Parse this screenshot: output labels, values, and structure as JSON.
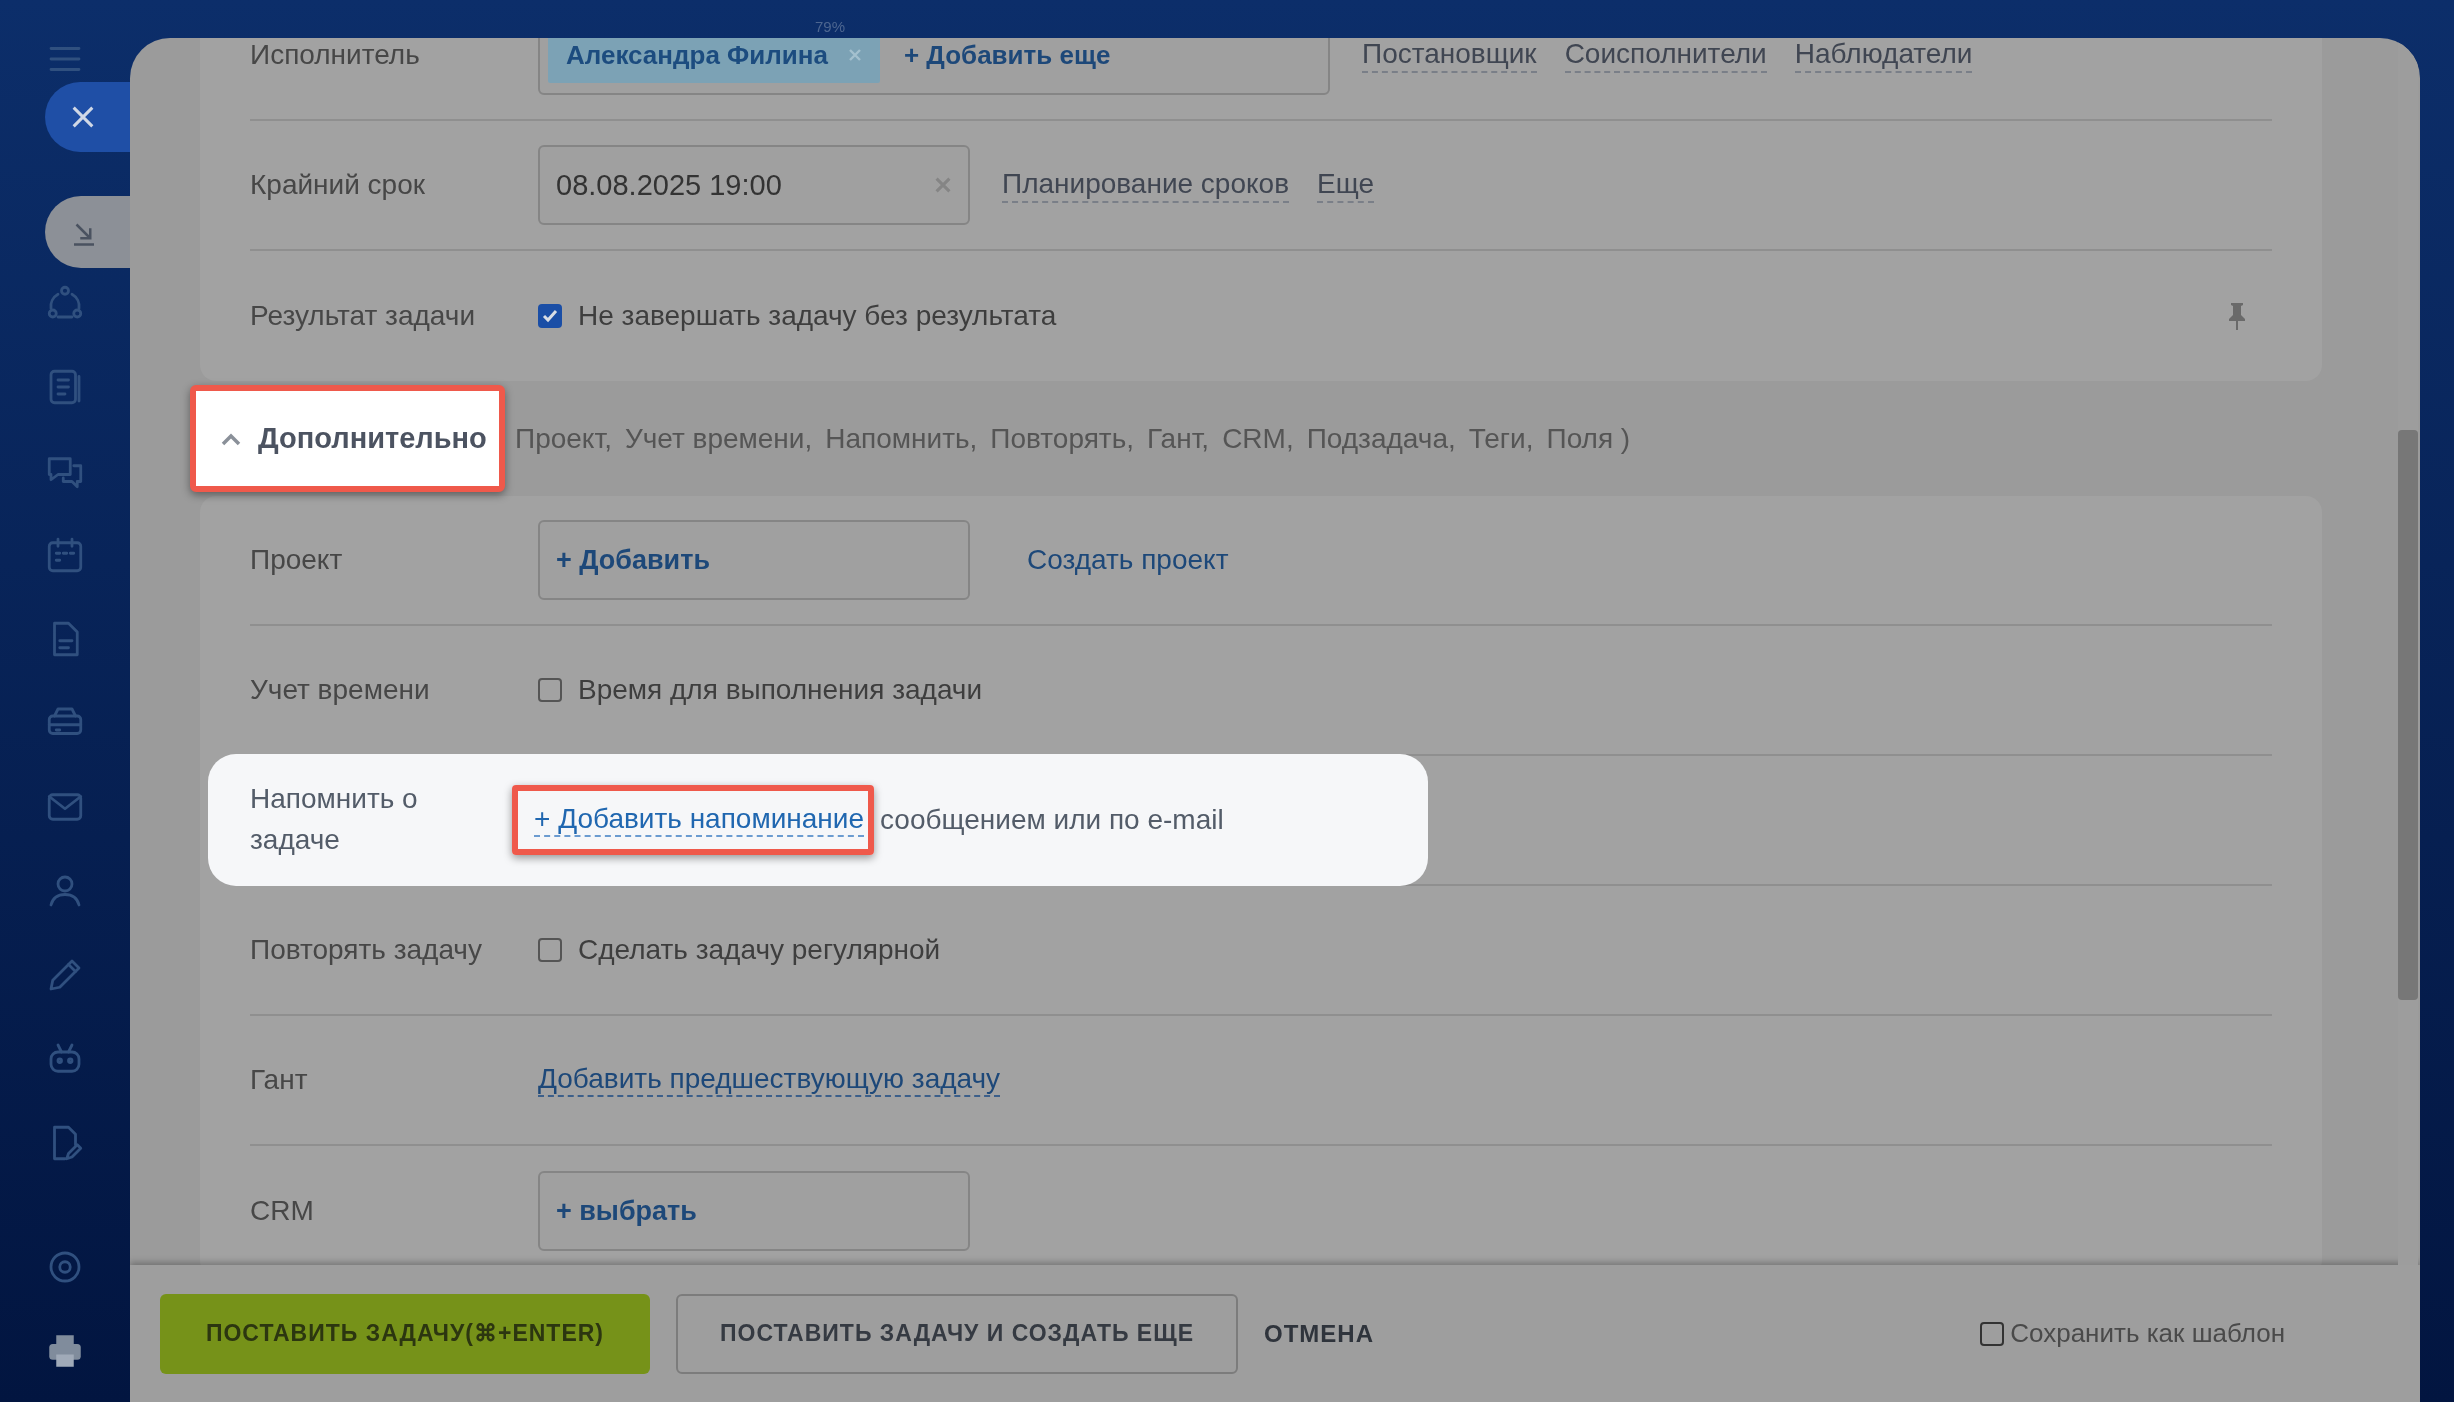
{
  "zoom_label": "79%",
  "rows": [
    {
      "kind": "people",
      "label": "Исполнитель",
      "chips": [
        "Александра Филина"
      ],
      "add": "+ Добавить еще",
      "links": [
        "Постановщик",
        "Соисполнители",
        "Наблюдатели"
      ]
    },
    {
      "kind": "date",
      "label": "Крайний срок",
      "value": "08.08.2025 19:00",
      "links": [
        "Планирование сроков",
        "Еще"
      ]
    },
    {
      "kind": "checkbox",
      "label": "Результат задачи",
      "checked": true,
      "text": "Не завершать задачу без результата",
      "pinned": true
    }
  ],
  "more": {
    "label": "Дополнительно",
    "expanded": true,
    "highlighted": true,
    "items": [
      "Проект,",
      "Учет времени,",
      "Напомнить,",
      "Повторять,",
      "Гант,",
      "CRM,",
      "Подзадача,",
      "Теги,",
      "Поля )"
    ]
  },
  "extra_rows": [
    {
      "kind": "add_button",
      "label": "Проект",
      "button": "+ Добавить",
      "link": "Создать проект",
      "highlighted": false
    },
    {
      "kind": "checkbox",
      "label": "Учет времени",
      "checked": false,
      "text": "Время для выполнения задачи",
      "highlighted": false
    },
    {
      "kind": "reminder",
      "label": "Напомнить о задаче",
      "link": "+ Добавить напоминание",
      "text": "сообщением или по e-mail",
      "highlighted": true
    },
    {
      "kind": "checkbox",
      "label": "Повторять задачу",
      "checked": false,
      "text": "Сделать задачу регулярной",
      "highlighted": false
    },
    {
      "kind": "link",
      "label": "Гант",
      "link": "Добавить предшествующую задачу",
      "highlighted": false
    },
    {
      "kind": "add_button",
      "label": "CRM",
      "button": "+  выбрать",
      "highlighted": false
    }
  ],
  "footer": {
    "submit": "ПОСТАВИТЬ ЗАДАЧУ(⌘+ENTER)",
    "submit_more": "ПОСТАВИТЬ ЗАДАЧУ И СОЗДАТЬ ЕЩЕ",
    "cancel": "ОТМЕНА",
    "template": {
      "label": "Сохранить как шаблон",
      "checked": false
    }
  }
}
